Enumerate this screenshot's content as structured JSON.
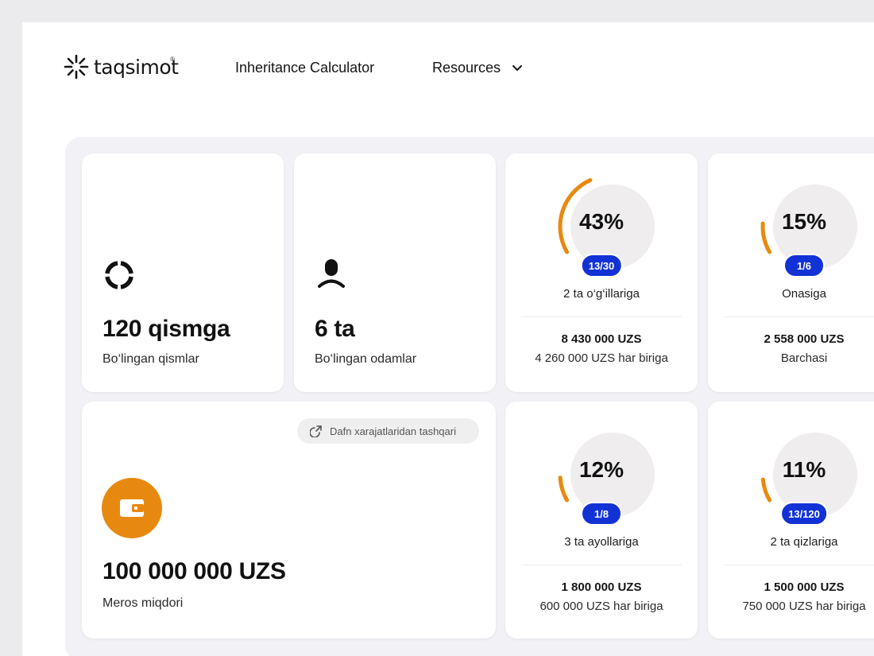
{
  "header": {
    "logo_text": "taqsimot",
    "logo_mark": "®",
    "nav": {
      "calculator": "Inheritance Calculator",
      "resources": "Resources"
    }
  },
  "stats": {
    "parts": {
      "value": "120 qismga",
      "label": "Bo‘lingan qismlar",
      "icon": "pie-segments-icon"
    },
    "people": {
      "value": "6 ta",
      "label": "Bo‘lingan odamlar",
      "icon": "person-icon"
    },
    "estate": {
      "value": "100 000 000 UZS",
      "label": "Meros miqdori",
      "icon": "wallet-icon",
      "pill": "Dafn xarajatlaridan tashqari"
    }
  },
  "shares": [
    {
      "percent_text": "43%",
      "percent": 43,
      "fraction": "13/30",
      "who": "2 ta o‘g‘illariga",
      "amount": "8 430 000 UZS",
      "each": "4 260 000 UZS har biriga"
    },
    {
      "percent_text": "15%",
      "percent": 15,
      "fraction": "1/6",
      "who": "Onasiga",
      "amount": "2 558 000 UZS",
      "each": "Barchasi"
    },
    {
      "percent_text": "12%",
      "percent": 12,
      "fraction": "1/8",
      "who": "3 ta ayollariga",
      "amount": "1 800 000 UZS",
      "each": "600 000 UZS har biriga"
    },
    {
      "percent_text": "11%",
      "percent": 11,
      "fraction": "13/120",
      "who": "2 ta qizlariga",
      "amount": "1 500 000 UZS",
      "each": "750 000 UZS har biriga"
    }
  ],
  "colors": {
    "accent_orange": "#e8890f",
    "badge_blue": "#1232d6",
    "panel": "#f2f1f5",
    "ring_track": "#efeded"
  }
}
